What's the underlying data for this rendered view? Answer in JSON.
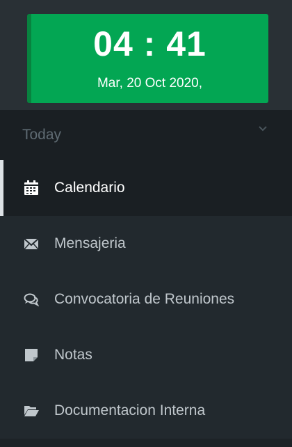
{
  "clock": {
    "time": "04 : 41",
    "date": "Mar, 20 Oct 2020,"
  },
  "today": {
    "label": "Today"
  },
  "menu": {
    "items": [
      {
        "label": "Calendario",
        "icon": "calendar-icon",
        "active": true
      },
      {
        "label": "Mensajeria",
        "icon": "envelope-icon",
        "active": false
      },
      {
        "label": "Convocatoria de Reuniones",
        "icon": "comments-icon",
        "active": false
      },
      {
        "label": "Notas",
        "icon": "sticky-note-icon",
        "active": false
      },
      {
        "label": "Documentacion Interna",
        "icon": "folder-open-icon",
        "active": false
      }
    ]
  },
  "colors": {
    "sidebar_bg": "#22292e",
    "clock_bg": "#03a653",
    "active_text": "#ffffff",
    "text": "#c0c7cc"
  }
}
